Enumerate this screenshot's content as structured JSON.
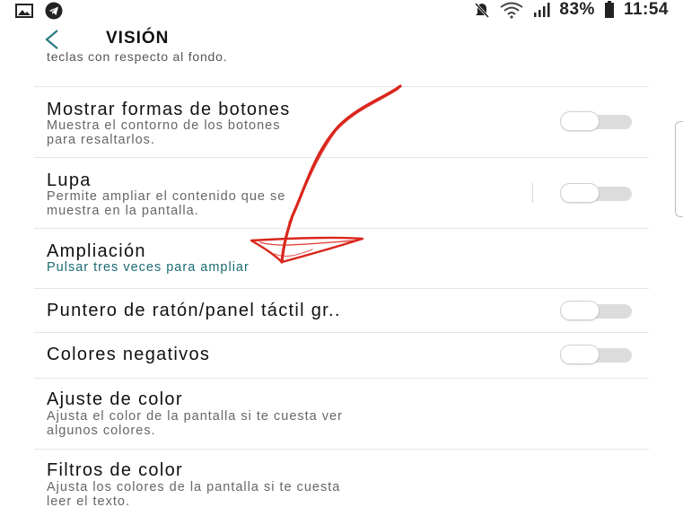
{
  "status_bar": {
    "battery": "83%",
    "time": "11:54"
  },
  "header": {
    "title": "VISIÓN"
  },
  "truncated_item": {
    "text": "teclas con respecto al fondo."
  },
  "settings": [
    {
      "title": "Mostrar formas de botones",
      "subtitle": "Muestra el contorno de los botones\npara resaltarlos.",
      "toggle": "off"
    },
    {
      "title": "Lupa",
      "subtitle": "Permite ampliar el contenido que se\nmuestra en la pantalla.",
      "toggle": "off"
    },
    {
      "title": "Ampliación",
      "subtitle": "Pulsar tres veces para ampliar"
    },
    {
      "title": "Puntero de ratón/panel táctil gr..",
      "toggle": "off"
    },
    {
      "title": "Colores negativos",
      "toggle": "off"
    },
    {
      "title": "Ajuste de color",
      "subtitle": "Ajusta el color de la pantalla si te cuesta ver\nalgunos colores."
    },
    {
      "title": "Filtros de color",
      "subtitle": "Ajusta los colores de la pantalla si te cuesta\nleer el texto."
    }
  ],
  "colors": {
    "accent_subtitle": "#1a6b73",
    "annotation": "#d9261c"
  }
}
